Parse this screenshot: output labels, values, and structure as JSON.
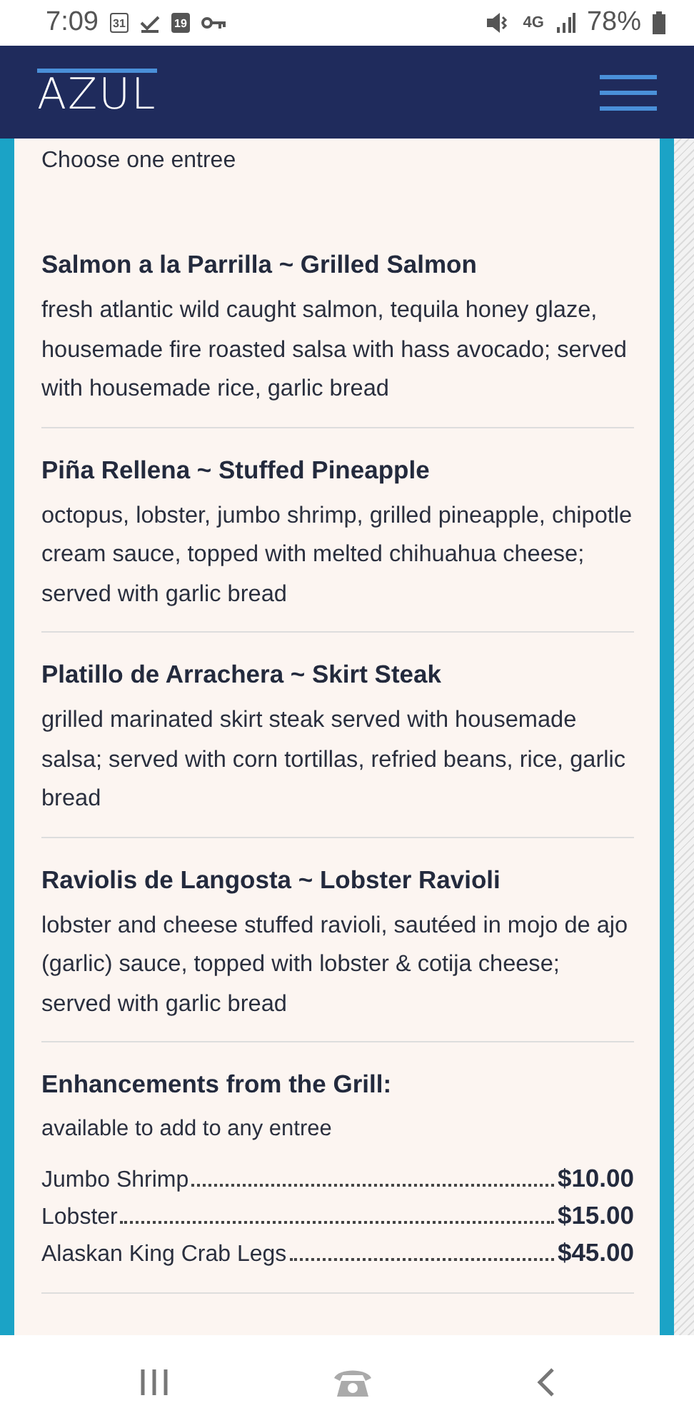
{
  "status_bar": {
    "time": "7:09",
    "calendar_day": "31",
    "event_day": "19",
    "network": "4G",
    "battery": "78%"
  },
  "header": {
    "logo": "AZUL"
  },
  "menu": {
    "intro": "Choose one entree",
    "entrees": [
      {
        "name": "Salmon a la Parrilla ~ Grilled Salmon",
        "description": "fresh atlantic wild caught salmon, tequila honey glaze, housemade fire roasted salsa with hass avocado; served with housemade rice, garlic bread"
      },
      {
        "name": "Piña Rellena ~ Stuffed Pineapple",
        "description": "octopus, lobster, jumbo shrimp, grilled pineapple, chipotle cream sauce, topped with melted chihuahua cheese; served with garlic bread"
      },
      {
        "name": "Platillo de Arrachera ~ Skirt Steak",
        "description": "grilled marinated skirt steak served with housemade salsa; served with corn tortillas, refried beans, rice, garlic bread"
      },
      {
        "name": "Raviolis de Langosta ~ Lobster Ravioli",
        "description": "lobster and cheese stuffed ravioli, sautéed in mojo de ajo (garlic) sauce, topped with lobster & cotija cheese; served with garlic bread"
      }
    ],
    "enhancements": {
      "title": "Enhancements from the Grill:",
      "note": "available to add to any entree",
      "items": [
        {
          "name": "Jumbo Shrimp",
          "price": "$10.00"
        },
        {
          "name": "Lobster",
          "price": "$15.00"
        },
        {
          "name": "Alaskan King Crab Legs",
          "price": "$45.00"
        }
      ]
    }
  }
}
